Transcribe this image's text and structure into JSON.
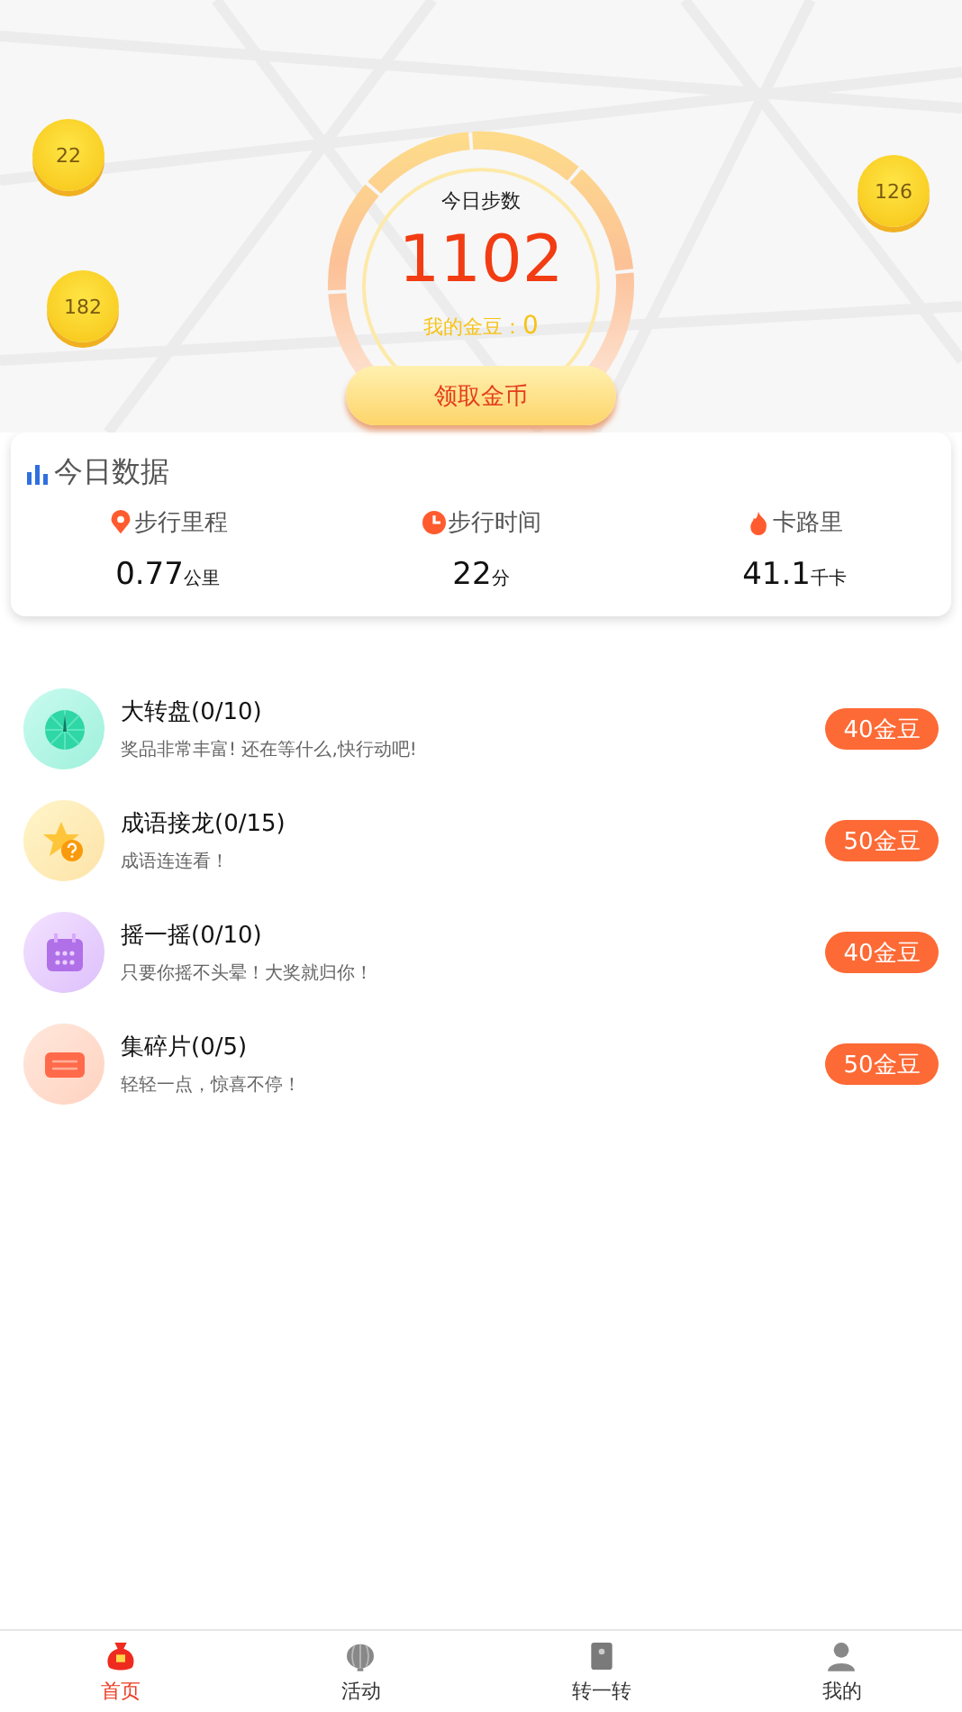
{
  "coins": [
    {
      "value": "22"
    },
    {
      "value": "182"
    },
    {
      "value": "126"
    }
  ],
  "steps": {
    "label": "今日步数",
    "count": "1102",
    "beans_label": "我的金豆：",
    "beans": "0",
    "claim_button": "领取金币"
  },
  "today": {
    "title": "今日数据",
    "stats": [
      {
        "kind": "distance",
        "label": "步行里程",
        "value": "0.77",
        "unit": "公里"
      },
      {
        "kind": "time",
        "label": "步行时间",
        "value": "22",
        "unit": "分"
      },
      {
        "kind": "calories",
        "label": "卡路里",
        "value": "41.1",
        "unit": "千卡"
      }
    ]
  },
  "tasks": [
    {
      "kind": "wheel",
      "title": "大转盘(0/10)",
      "desc": "奖品非常丰富! 还在等什么,快行动吧!",
      "reward": "40金豆"
    },
    {
      "kind": "idiom",
      "title": "成语接龙(0/15)",
      "desc": "成语连连看！",
      "reward": "50金豆"
    },
    {
      "kind": "shake",
      "title": "摇一摇(0/10)",
      "desc": "只要你摇不头晕！大奖就归你！",
      "reward": "40金豆"
    },
    {
      "kind": "fragment",
      "title": "集碎片(0/5)",
      "desc": "轻轻一点，惊喜不停！",
      "reward": "50金豆"
    }
  ],
  "tabs": [
    {
      "kind": "home",
      "label": "首页",
      "selected": true
    },
    {
      "kind": "activity",
      "label": "活动",
      "selected": false
    },
    {
      "kind": "spin",
      "label": "转一转",
      "selected": false
    },
    {
      "kind": "mine",
      "label": "我的",
      "selected": false
    }
  ]
}
